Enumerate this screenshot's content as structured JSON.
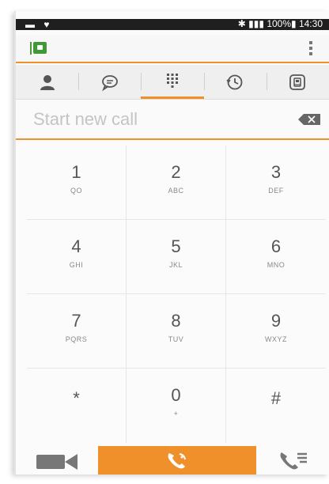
{
  "status_bar": {
    "left_icons": "▬ ♥",
    "right_text": "✱ ▮▮▮ 100%▮ 14:30"
  },
  "app_bar": {
    "logo_icon": "app-logo-icon",
    "menu_icon": "overflow-menu-icon"
  },
  "tabs": [
    {
      "icon": "contacts-icon",
      "active": false
    },
    {
      "icon": "chat-icon",
      "active": false
    },
    {
      "icon": "dialpad-icon",
      "active": true
    },
    {
      "icon": "history-icon",
      "active": false
    },
    {
      "icon": "voicemail-icon",
      "active": false
    }
  ],
  "dial_input": {
    "placeholder": "Start new call",
    "value": ""
  },
  "keys": [
    {
      "digit": "1",
      "letters": "QO"
    },
    {
      "digit": "2",
      "letters": "ABC"
    },
    {
      "digit": "3",
      "letters": "DEF"
    },
    {
      "digit": "4",
      "letters": "GHI"
    },
    {
      "digit": "5",
      "letters": "JKL"
    },
    {
      "digit": "6",
      "letters": "MNO"
    },
    {
      "digit": "7",
      "letters": "PQRS"
    },
    {
      "digit": "8",
      "letters": "TUV"
    },
    {
      "digit": "9",
      "letters": "WXYZ"
    },
    {
      "digit": "*",
      "letters": ""
    },
    {
      "digit": "0",
      "letters": "+"
    },
    {
      "digit": "#",
      "letters": ""
    }
  ],
  "colors": {
    "accent": "#f0902a",
    "icon_gray": "#666666"
  }
}
